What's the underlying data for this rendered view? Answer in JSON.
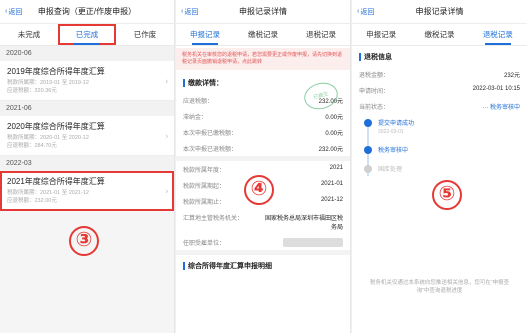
{
  "screen1": {
    "nav": {
      "back": "返回",
      "title": "申报查询（更正/作废申报）"
    },
    "tabs": [
      "未完成",
      "已完成",
      "已作废"
    ],
    "groups": [
      {
        "header": "2020-06",
        "records": [
          {
            "title": "2019年度综合所得年度汇算",
            "period": "税款所属期：2019-01 至 2019-12",
            "amount": "应退税额：320.36元"
          }
        ]
      },
      {
        "header": "2021-06",
        "records": [
          {
            "title": "2020年度综合所得年度汇算",
            "period": "税款所属期：2020-01 至 2020-12",
            "amount": "应退税额：284.70元"
          }
        ]
      },
      {
        "header": "2022-03",
        "records": [
          {
            "title": "2021年度综合所得年度汇算",
            "period": "税款所属期：2021-01 至 2021-12",
            "amount": "应退税额：232.00元"
          }
        ]
      }
    ],
    "marker": "③"
  },
  "screen2": {
    "nav": {
      "back": "返回",
      "title": "申报记录详情"
    },
    "tabs": [
      "申报记录",
      "缴税记录",
      "退税记录"
    ],
    "notice": "税务机关在审核您的退税申请，若您需要更正或作废申报，请先切换到退税记录页面撤销退税申请，点此跳转",
    "section_title": "缴款详情：",
    "stamp": "已提交",
    "rows": [
      {
        "k": "应退税额：",
        "v": "232.00元"
      },
      {
        "k": "滞纳金：",
        "v": "0.00元"
      },
      {
        "k": "本次申报已缴税额：",
        "v": "0.00元"
      },
      {
        "k": "本次申报已退税额：",
        "v": "232.00元"
      }
    ],
    "rows2": [
      {
        "k": "税款所属年度：",
        "v": "2021"
      },
      {
        "k": "税款所属期起：",
        "v": "2021-01"
      },
      {
        "k": "税款所属期止：",
        "v": "2021-12"
      },
      {
        "k": "汇算地主管税务机关：",
        "v": "国家税务总局深圳市福田区税务局"
      },
      {
        "k": "任职受雇单位：",
        "v": ""
      }
    ],
    "bottom_section": "综合所得年度汇算申报明细",
    "marker": "④"
  },
  "screen3": {
    "nav": {
      "back": "返回",
      "title": "申报记录详情"
    },
    "tabs": [
      "申报记录",
      "缴税记录",
      "退税记录"
    ],
    "section_title": "退税信息",
    "rows": [
      {
        "k": "退税金额：",
        "v": "232元"
      },
      {
        "k": "申请时间：",
        "v": "2022-03-01 10:15"
      },
      {
        "k": "当前状态：",
        "v": "··· 税务审核中"
      }
    ],
    "timeline": [
      {
        "label": "提交申请成功",
        "date": "2022-03-01"
      },
      {
        "label": "税务审核中",
        "date": ""
      },
      {
        "label": "国库处理",
        "date": ""
      }
    ],
    "footer": "税务机关仅通过本系统向您推送相关信息，您可在“申报查询”中查询退税进度",
    "marker": "⑤"
  }
}
